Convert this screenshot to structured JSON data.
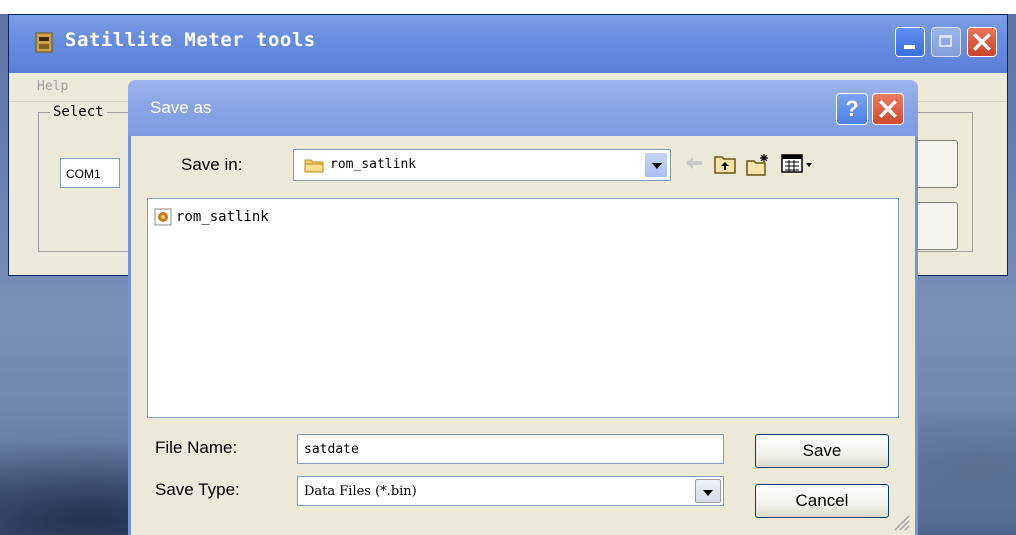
{
  "desktop": {},
  "main_window": {
    "title": "Satillite Meter tools",
    "menu": {
      "help_label": "Help"
    },
    "group_label": "Select",
    "com_port_value": "COM1"
  },
  "dialog": {
    "title": "Save as",
    "help_button": "?",
    "save_in_label": "Save in:",
    "save_in_value": "rom_satlink",
    "files": [
      {
        "name": "rom_satlink",
        "icon": "file-icon"
      }
    ],
    "file_name_label": "File Name:",
    "file_name_value": "satdate",
    "save_type_label": "Save Type:",
    "save_type_value": "Data Files (*.bin)",
    "save_button": "Save",
    "cancel_button": "Cancel"
  },
  "colors": {
    "title_bar": "#6a8edf",
    "dialog_title_bar": "#8aa4e6",
    "window_face": "#ece9d8",
    "close_red": "#cf4a2f"
  }
}
